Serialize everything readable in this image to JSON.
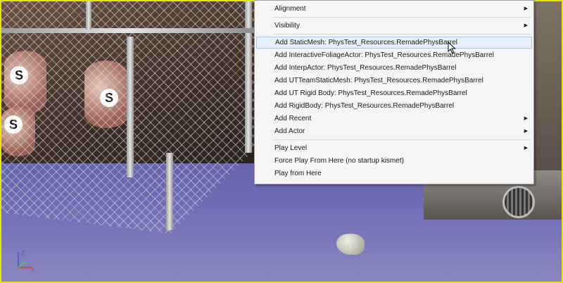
{
  "menu": {
    "groups": [
      [
        {
          "label": "Alignment",
          "submenu": true
        },
        {
          "label": "Visibility",
          "submenu": true
        }
      ],
      [
        {
          "label": "Add StaticMesh: PhysTest_Resources.RemadePhysBarrel",
          "highlighted": true
        },
        {
          "label": "Add InteractiveFoliageActor: PhysTest_Resources.RemadePhysBarrel"
        },
        {
          "label": "Add InterpActor: PhysTest_Resources.RemadePhysBarrel"
        },
        {
          "label": "Add UTTeamStaticMesh: PhysTest_Resources.RemadePhysBarrel"
        },
        {
          "label": "Add UT Rigid Body: PhysTest_Resources.RemadePhysBarrel"
        },
        {
          "label": "Add RigidBody: PhysTest_Resources.RemadePhysBarrel"
        },
        {
          "label": "Add Recent",
          "submenu": true
        },
        {
          "label": "Add Actor",
          "submenu": true
        }
      ],
      [
        {
          "label": "Play Level",
          "submenu": true
        },
        {
          "label": "Force Play From Here (no startup kismet)"
        },
        {
          "label": "Play from Here"
        }
      ]
    ]
  },
  "viewport": {
    "border_color": "#e6e600",
    "barrel_marks": [
      "S",
      "S",
      "S"
    ],
    "axis_labels": {
      "z": "Z",
      "x": "X"
    }
  }
}
